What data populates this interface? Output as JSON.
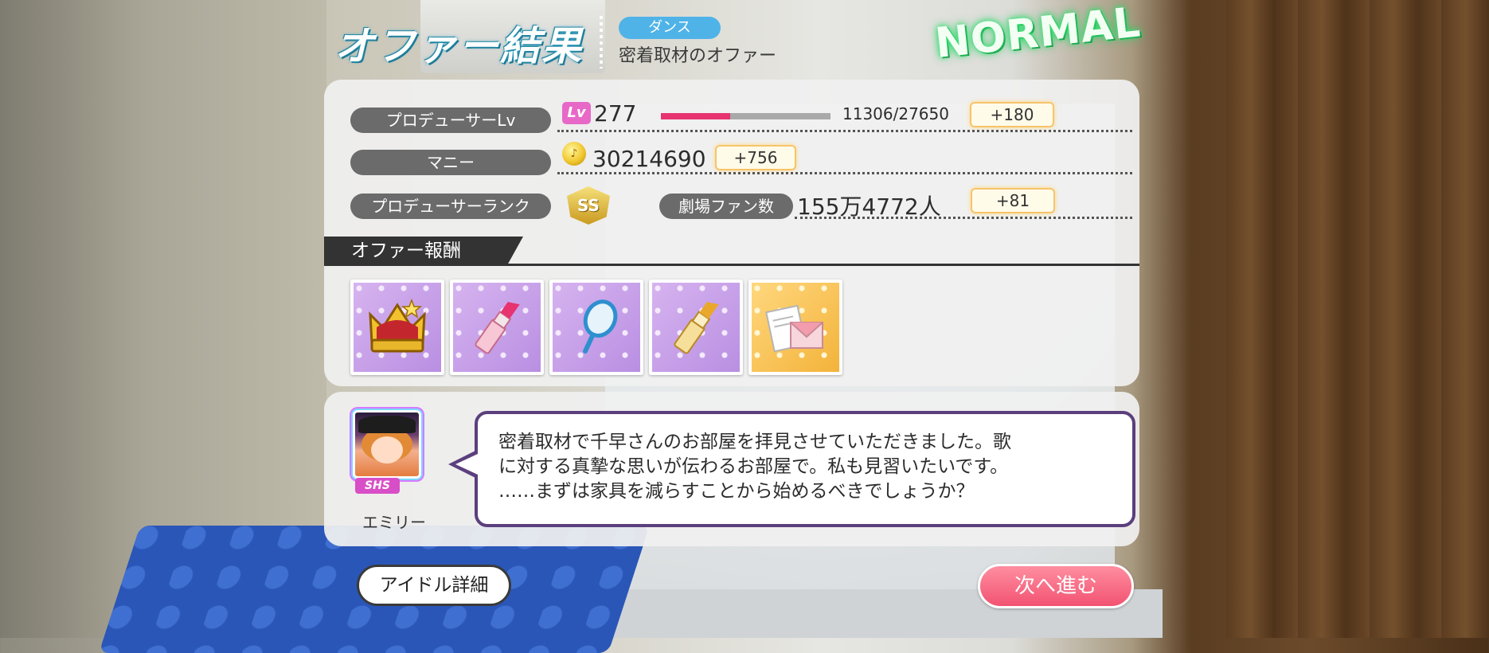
{
  "header": {
    "title": "オファー結果",
    "type_pill": "ダンス",
    "offer_name": "密着取材のオファー",
    "difficulty": "NORMAL"
  },
  "stats": {
    "producer_lv": {
      "label": "プロデューサーLv",
      "icon_text": "Lv",
      "value": "277",
      "progress": "11306/27650",
      "progress_fraction": 0.409,
      "gain": "+180"
    },
    "money": {
      "label": "マニー",
      "value": "30214690",
      "gain": "+756"
    },
    "rank": {
      "label": "プロデューサーランク",
      "badge": "SS"
    },
    "fans": {
      "label": "劇場ファン数",
      "value": "155万4772人",
      "gain": "+81"
    }
  },
  "rewards": {
    "header": "オファー報酬",
    "items": [
      {
        "icon": "crown-icon",
        "frame": "purple"
      },
      {
        "icon": "pink-lipstick-icon",
        "frame": "purple"
      },
      {
        "icon": "hand-mirror-icon",
        "frame": "purple"
      },
      {
        "icon": "gold-lipstick-icon",
        "frame": "purple"
      },
      {
        "icon": "letter-envelope-icon",
        "frame": "gold"
      }
    ]
  },
  "message": {
    "idol_name": "エミリー",
    "rarity": "SHS",
    "lines": [
      "密着取材で千早さんのお部屋を拝見させていただきました。歌",
      "に対する真摯な思いが伝わるお部屋で。私も見習いたいです。",
      "……まずは家具を減らすことから始めるべきでしょうか？"
    ]
  },
  "buttons": {
    "idol_detail": "アイドル詳細",
    "next": "次へ進む"
  },
  "colors": {
    "accent_pink": "#f25372",
    "exp_bar": "#e7336f",
    "bubble_border": "#5b3f7d",
    "normal_glow": "#3be87a"
  }
}
